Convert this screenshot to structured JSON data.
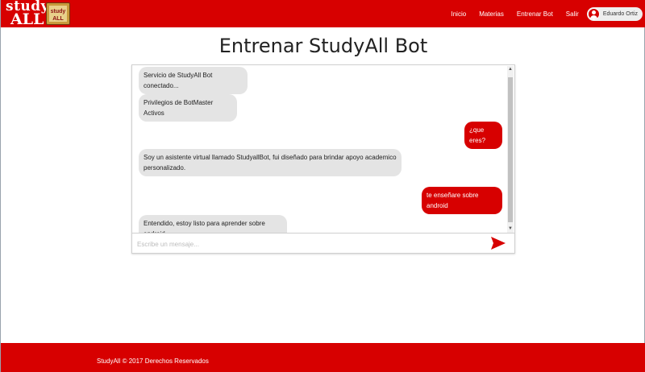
{
  "brand": {
    "logo_top": "study",
    "logo_bottom": "ALL",
    "book_text_1": "study",
    "book_text_2": "ALL"
  },
  "nav": {
    "links": [
      "Inicio",
      "Materias",
      "Entrenar Bot",
      "Salir"
    ],
    "user_name": "Eduardo Ortiz"
  },
  "page": {
    "title": "Entrenar StudyAll Bot"
  },
  "chat": {
    "messages": [
      {
        "from": "bot",
        "text": "Servicio de StudyAll Bot conectado..."
      },
      {
        "from": "bot",
        "text": "Privilegios de BotMaster Activos"
      },
      {
        "from": "user",
        "text": "¿que eres?"
      },
      {
        "from": "bot",
        "text": "Soy un asistente virtual llamado StudyallBot, fui diseñado para brindar apoyo academico personalizado."
      },
      {
        "from": "user",
        "text": "te enseñare sobre android"
      },
      {
        "from": "bot",
        "text": "Entendido, estoy listo para aprender sobre android."
      }
    ],
    "input_placeholder": "Escribe un mensaje...",
    "input_value": ""
  },
  "footer": {
    "text": "StudyAll © 2017 Derechos Reservados"
  },
  "colors": {
    "brand_red": "#d70000",
    "bot_bubble": "#e4e4e4",
    "user_bubble": "#d70000"
  },
  "icons": {
    "send": "send-icon",
    "user": "user-icon"
  }
}
